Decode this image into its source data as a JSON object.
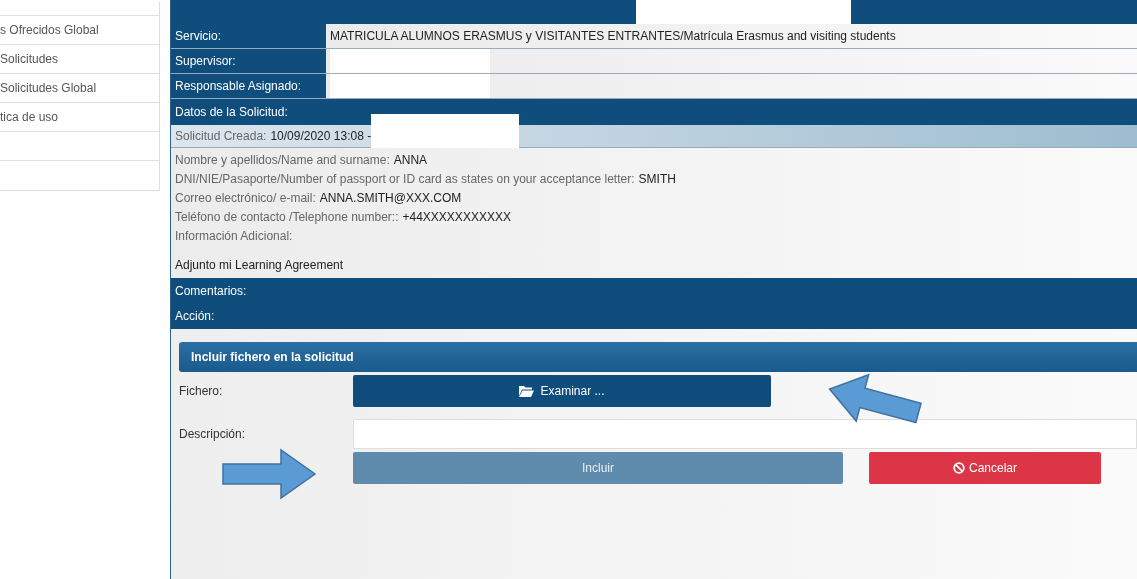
{
  "sidebar": {
    "items": [
      {
        "label": "s Ofrecidos Global"
      },
      {
        "label": "Solicitudes"
      },
      {
        "label": "Solicitudes Global"
      },
      {
        "label": "tica de uso"
      }
    ]
  },
  "details": [
    {
      "label": "Servicio:",
      "value": "MATRICULA ALUMNOS ERASMUS y VISITANTES ENTRANTES/Matrícula Erasmus and visiting students",
      "redacted": false
    },
    {
      "label": "Supervisor:",
      "redacted": true
    },
    {
      "label": "Responsable Asignado:",
      "redacted": true
    }
  ],
  "request": {
    "header": "Datos de la Solicitud:",
    "created_label": "Solicitud Creada:",
    "created_value": "10/09/2020 13:08 -",
    "fields": [
      {
        "label": "Nombre y apellidos/Name and surname:",
        "value": "ANNA"
      },
      {
        "label": "DNI/NIE/Pasaporte/Number of passport or ID card as states on your acceptance letter:",
        "value": "SMITH"
      },
      {
        "label": "Correo electrónico/ e-mail:",
        "value": "ANNA.SMITH@XXX.COM"
      },
      {
        "label": "Teléfono de contacto /Telephone number::",
        "value": "+44XXXXXXXXXXX"
      },
      {
        "label": "Información Adicional:"
      }
    ],
    "additional_text": "Adjunto mi Learning Agreement"
  },
  "comments_label": "Comentarios:",
  "action_label": "Acción:",
  "upload": {
    "title": "Incluir fichero en la solicitud",
    "file_label": "Fichero:",
    "browse_button": "Examinar ...",
    "description_label": "Descripción:",
    "include_button": {
      "label": "Incluir",
      "disabled": true
    },
    "cancel_button": {
      "label": "Cancelar",
      "disabled": false
    }
  }
}
